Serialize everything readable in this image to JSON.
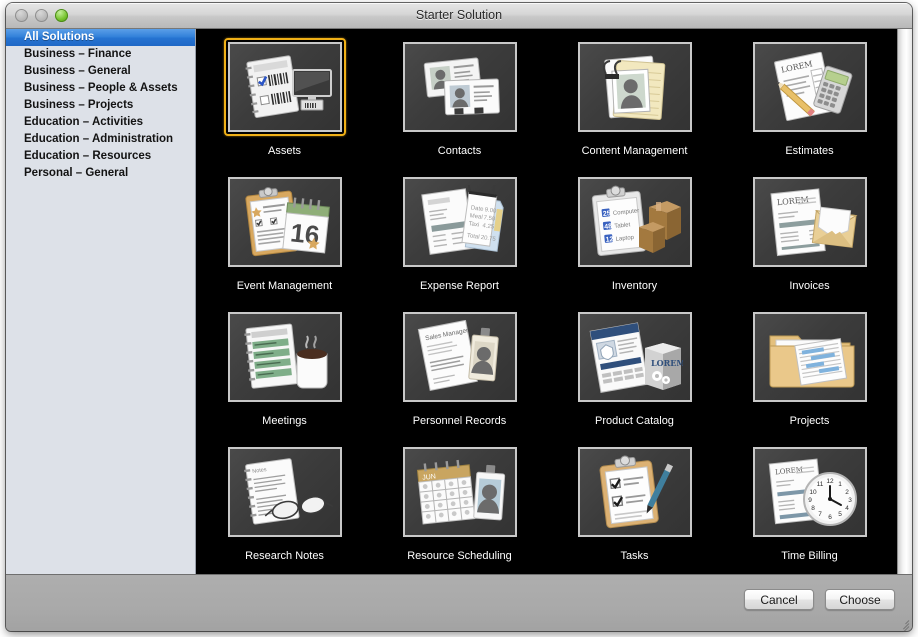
{
  "window": {
    "title": "Starter Solution",
    "controls": {
      "close": "close-button",
      "minimize": "minimize-button",
      "zoom": "zoom-button"
    },
    "accent_selected_tile": "#f0b017",
    "accent_sidebar_selection": "#2f7ed8",
    "content_background": "#000000",
    "sidebar_background": "#dde1e8"
  },
  "sidebar": {
    "items": [
      {
        "label": "All Solutions",
        "selected": true
      },
      {
        "label": "Business – Finance",
        "selected": false
      },
      {
        "label": "Business – General",
        "selected": false
      },
      {
        "label": "Business – People & Assets",
        "selected": false
      },
      {
        "label": "Business – Projects",
        "selected": false
      },
      {
        "label": "Education – Activities",
        "selected": false
      },
      {
        "label": "Education – Administration",
        "selected": false
      },
      {
        "label": "Education – Resources",
        "selected": false
      },
      {
        "label": "Personal – General",
        "selected": false
      }
    ]
  },
  "solutions": [
    {
      "label": "Assets",
      "icon": "assets-icon",
      "selected": true
    },
    {
      "label": "Contacts",
      "icon": "contacts-icon",
      "selected": false
    },
    {
      "label": "Content Management",
      "icon": "content-management-icon",
      "selected": false
    },
    {
      "label": "Estimates",
      "icon": "estimates-icon",
      "selected": false
    },
    {
      "label": "Event Management",
      "icon": "event-management-icon",
      "selected": false
    },
    {
      "label": "Expense Report",
      "icon": "expense-report-icon",
      "selected": false
    },
    {
      "label": "Inventory",
      "icon": "inventory-icon",
      "selected": false
    },
    {
      "label": "Invoices",
      "icon": "invoices-icon",
      "selected": false
    },
    {
      "label": "Meetings",
      "icon": "meetings-icon",
      "selected": false
    },
    {
      "label": "Personnel Records",
      "icon": "personnel-records-icon",
      "selected": false
    },
    {
      "label": "Product Catalog",
      "icon": "product-catalog-icon",
      "selected": false
    },
    {
      "label": "Projects",
      "icon": "projects-icon",
      "selected": false
    },
    {
      "label": "Research Notes",
      "icon": "research-notes-icon",
      "selected": false
    },
    {
      "label": "Resource Scheduling",
      "icon": "resource-scheduling-icon",
      "selected": false
    },
    {
      "label": "Tasks",
      "icon": "tasks-icon",
      "selected": false
    },
    {
      "label": "Time Billing",
      "icon": "time-billing-icon",
      "selected": false
    }
  ],
  "footer": {
    "cancel_label": "Cancel",
    "choose_label": "Choose"
  }
}
